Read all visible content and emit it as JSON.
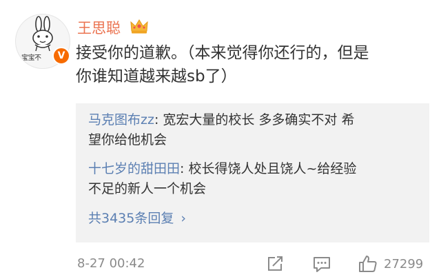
{
  "user": {
    "name": "王思聪",
    "avatar_caption": "宝宝不",
    "badge": "V",
    "accent_color": "#eb7350",
    "icons": [
      "crown-icon",
      "verified-icon"
    ]
  },
  "comment": {
    "line1": "接受你的道歉。（本来觉得你还行的，但是",
    "line2": "你谁知道越来越sb了）"
  },
  "replies": [
    {
      "author": "马克图布zz",
      "text_line1": ": 宽宏大量的校长  多多确实不对 希",
      "text_line2": "望你给他机会"
    },
    {
      "author": "十七岁的甜田田",
      "text_line1": ": 校长得饶人处且饶人~给经验",
      "text_line2": "不足的新人一个机会"
    }
  ],
  "reply_count_label": "共3435条回复",
  "reply_count_chevron": "›",
  "footer": {
    "timestamp": "8-27 00:42",
    "like_count": "27299",
    "icons": [
      "repost-icon",
      "comment-icon",
      "like-icon"
    ]
  },
  "colors": {
    "link": "#5b7fb2",
    "text": "#333333",
    "muted": "#8a8a8a",
    "reply_bg": "#f2f2f2"
  }
}
